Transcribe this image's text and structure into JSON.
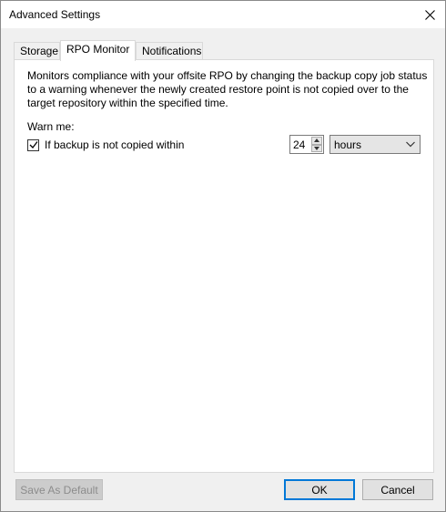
{
  "window": {
    "title": "Advanced Settings"
  },
  "tabs": [
    {
      "label": "Storage",
      "active": false
    },
    {
      "label": "RPO Monitor",
      "active": true
    },
    {
      "label": "Notifications",
      "active": false
    }
  ],
  "rpo": {
    "description": "Monitors compliance with your offsite RPO by changing the backup copy job status to a warning whenever the newly created restore point is not copied over to the target repository within the specified time.",
    "warn_label": "Warn me:",
    "checkbox_label": "If backup is not copied within",
    "checked": true,
    "interval_value": "24",
    "unit_selected": "hours"
  },
  "footer": {
    "save_default_label": "Save As Default",
    "ok_label": "OK",
    "cancel_label": "Cancel"
  },
  "icons": {
    "close": "close-icon",
    "check": "checkmark-icon",
    "up": "caret-up-icon",
    "down": "caret-down-icon",
    "dropdown": "chevron-down-icon"
  }
}
